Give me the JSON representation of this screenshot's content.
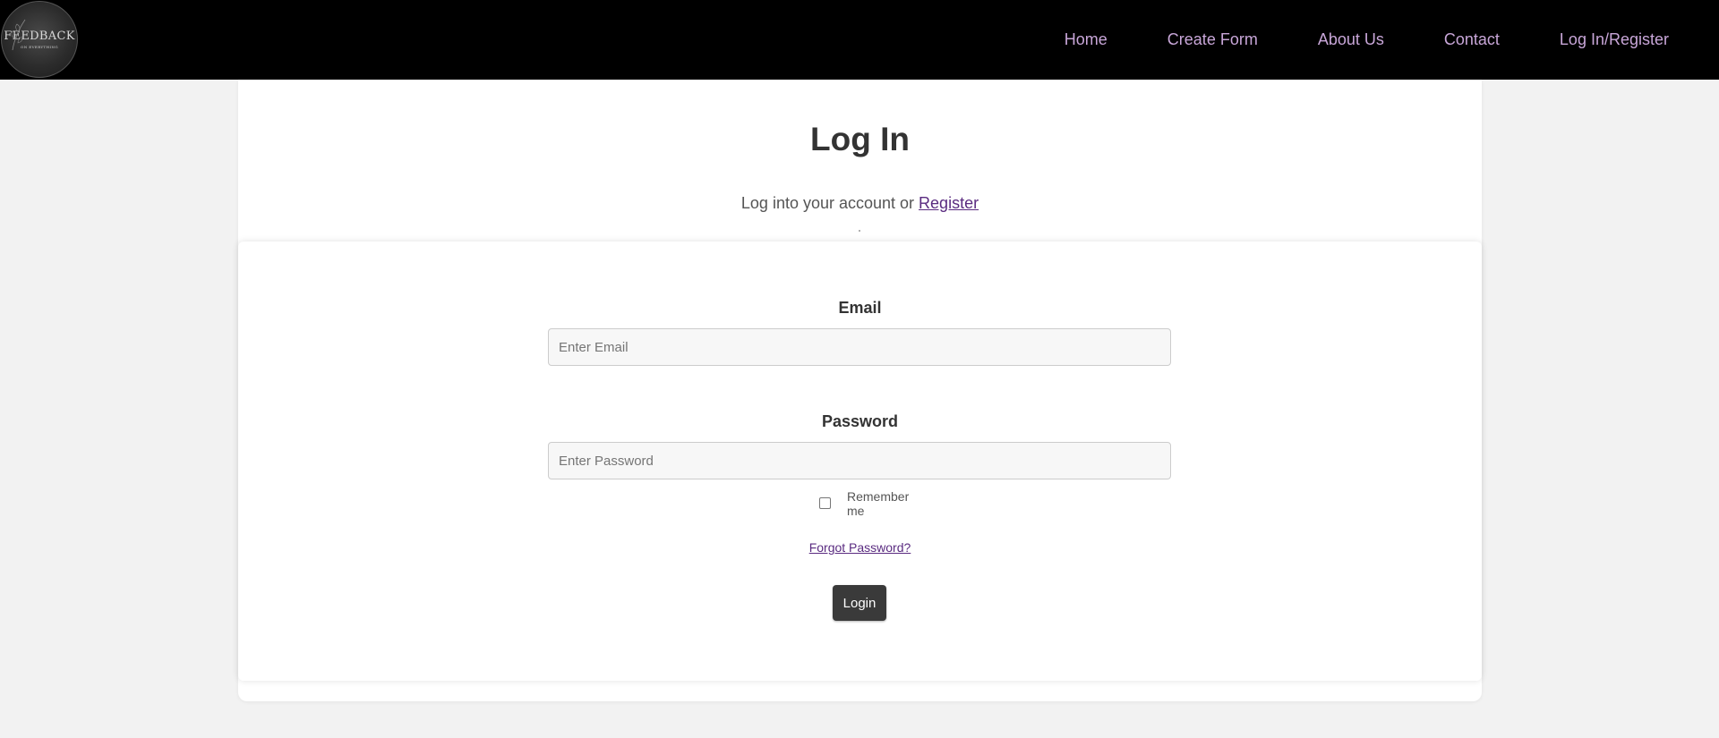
{
  "logo": {
    "title": "FEEDBACK",
    "subtitle": "ON EVERYTHING"
  },
  "nav": {
    "items": [
      {
        "label": "Home"
      },
      {
        "label": "Create Form"
      },
      {
        "label": "About Us"
      },
      {
        "label": "Contact"
      },
      {
        "label": "Log In/Register"
      }
    ]
  },
  "main": {
    "title": "Log In",
    "subtitle_prefix": "Log into your account or",
    "register_link": "Register"
  },
  "form": {
    "email_label": "Email",
    "email_placeholder": "Enter Email",
    "password_label": "Password",
    "password_placeholder": "Enter Password",
    "remember_label": "Remember me",
    "remember_checked": false,
    "forgot_link": "Forgot Password?",
    "login_button": "Login"
  },
  "colors": {
    "nav_background": "#000000",
    "nav_link": "#c8a6d8",
    "link": "#5a2b80",
    "button": "#3a3a3a",
    "page_background": "#f2f2f2"
  }
}
